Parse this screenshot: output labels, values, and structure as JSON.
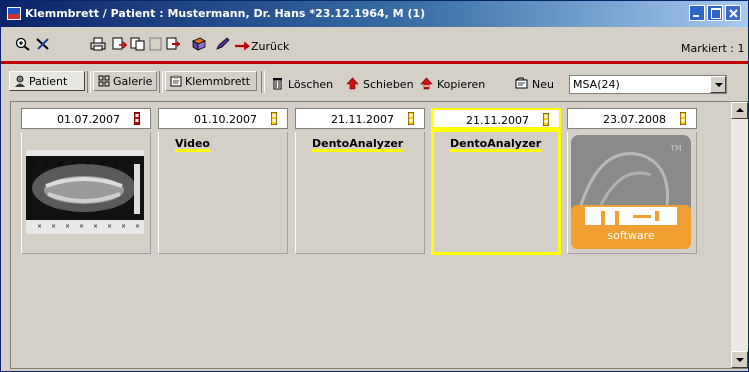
{
  "window": {
    "title": "Klemmbrett  /  Patient : Mustermann, Dr. Hans  *23.12.1964, M (1)"
  },
  "toolbar": {
    "back_label": "Zurück",
    "marked_label": "Markiert : 1"
  },
  "tabs": [
    {
      "label": "Patient",
      "icon": "patient-icon",
      "active": true
    },
    {
      "label": "Galerie",
      "icon": "gallery-icon",
      "active": false
    },
    {
      "label": "Klemmbrett",
      "icon": "clipboard-icon",
      "active": false
    }
  ],
  "actions": {
    "delete_label": "Löschen",
    "move_label": "Schieben",
    "copy_label": "Kopieren",
    "new_label": "Neu"
  },
  "filter": {
    "selected": "MSA(24)"
  },
  "cards": [
    {
      "date": "01.07.2007",
      "label": "",
      "kind": "xray",
      "flag_color": "#cc0000",
      "selected": false
    },
    {
      "date": "01.10.2007",
      "label": "Video",
      "kind": "text",
      "flag_color": "#ffcc00",
      "selected": false
    },
    {
      "date": "21.11.2007",
      "label": "DentoAnalyzer",
      "kind": "text",
      "flag_color": "#ffcc00",
      "selected": false
    },
    {
      "date": "21.11.2007",
      "label": "DentoAnalyzer",
      "kind": "text",
      "flag_color": "#ffcc00",
      "selected": true
    },
    {
      "date": "23.07.2008",
      "label": "",
      "kind": "logo",
      "flag_color": "#ffcc00",
      "selected": false,
      "logo_text": "software",
      "logo_tm": "TM"
    }
  ],
  "colors": {
    "accent_red": "#c00000",
    "selection_yellow": "#ffff00",
    "logo_orange": "#f0a030"
  }
}
